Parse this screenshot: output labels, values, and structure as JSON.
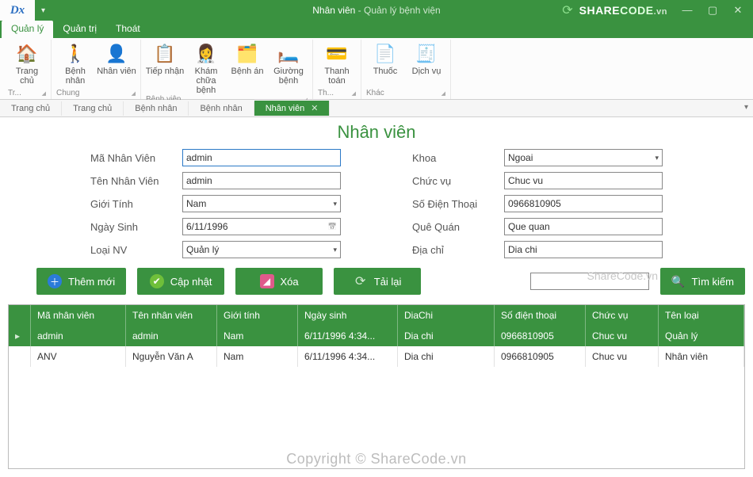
{
  "titlebar": {
    "logo": "Dx",
    "doc": "Nhân viên",
    "app": "Quản lý bệnh viện",
    "brand_share": "SHARE",
    "brand_code": "CODE",
    "brand_vn": ".vn"
  },
  "ribbon": {
    "tabs": [
      "Quản lý",
      "Quản trị",
      "Thoát"
    ],
    "active_tab": 0,
    "groups": [
      {
        "label": "Tr...",
        "items": [
          {
            "label": "Trang\nchủ",
            "icon": "🏠",
            "name": "ribbon-home"
          }
        ]
      },
      {
        "label": "Chung",
        "items": [
          {
            "label": "Bệnh nhân",
            "icon": "🚶",
            "name": "ribbon-patient"
          },
          {
            "label": "Nhân viên",
            "icon": "👤",
            "name": "ribbon-staff"
          }
        ]
      },
      {
        "label": "Bệnh viện",
        "items": [
          {
            "label": "Tiếp nhận",
            "icon": "📋",
            "name": "ribbon-reception"
          },
          {
            "label": "Khám chữa\nbệnh",
            "icon": "👩‍⚕️",
            "name": "ribbon-exam"
          },
          {
            "label": "Bệnh án",
            "icon": "🗂️",
            "name": "ribbon-record"
          },
          {
            "label": "Giường\nbệnh",
            "icon": "🛏️",
            "name": "ribbon-bed"
          }
        ]
      },
      {
        "label": "Th...",
        "items": [
          {
            "label": "Thanh\ntoán",
            "icon": "💳",
            "name": "ribbon-payment"
          }
        ]
      },
      {
        "label": "Khác",
        "items": [
          {
            "label": "Thuốc",
            "icon": "📄",
            "name": "ribbon-medicine"
          },
          {
            "label": "Dịch vụ",
            "icon": "🧾",
            "name": "ribbon-service"
          }
        ]
      }
    ]
  },
  "doctabs": {
    "tabs": [
      "Trang chủ",
      "Trang chủ",
      "Bệnh nhân",
      "Bệnh nhân",
      "Nhân viên"
    ],
    "active": 4
  },
  "page": {
    "title": "Nhân viên",
    "left": [
      {
        "label": "Mã Nhân Viên",
        "value": "admin",
        "type": "text",
        "hi": true,
        "name": "field-staff-id"
      },
      {
        "label": "Tên Nhân Viên",
        "value": "admin",
        "type": "text",
        "name": "field-staff-name"
      },
      {
        "label": "Giới Tính",
        "value": "Nam",
        "type": "select",
        "name": "field-gender"
      },
      {
        "label": "Ngày Sinh",
        "value": "6/11/1996",
        "type": "date",
        "name": "field-birthdate"
      },
      {
        "label": "Loại NV",
        "value": "Quản lý",
        "type": "select",
        "name": "field-staff-type"
      }
    ],
    "right": [
      {
        "label": "Khoa",
        "value": "Ngoai",
        "type": "select",
        "name": "field-department"
      },
      {
        "label": "Chức vụ",
        "value": "Chuc vu",
        "type": "text",
        "name": "field-position"
      },
      {
        "label": "Số Điện Thoại",
        "value": "0966810905",
        "type": "text",
        "name": "field-phone"
      },
      {
        "label": "Quê Quán",
        "value": "Que quan",
        "type": "text",
        "name": "field-hometown"
      },
      {
        "label": "Địa chỉ",
        "value": "Dia chi",
        "type": "text",
        "name": "field-address"
      }
    ]
  },
  "actions": {
    "add": "Thêm mới",
    "update": "Cập nhật",
    "delete": "Xóa",
    "reload": "Tải lại",
    "search": "Tìm kiếm",
    "search_value": ""
  },
  "grid": {
    "columns": [
      "Mã nhân viên",
      "Tên nhân viên",
      "Giới tính",
      "Ngày sinh",
      "DiaChi",
      "Số điện thoại",
      "Chức vụ",
      "Tên loại"
    ],
    "rows": [
      {
        "selected": true,
        "cells": [
          "admin",
          "admin",
          "Nam",
          "6/11/1996 4:34...",
          "Dia chi",
          "0966810905",
          "Chuc vu",
          "Quản lý"
        ]
      },
      {
        "selected": false,
        "cells": [
          "ANV",
          "Nguyễn Văn A",
          "Nam",
          "6/11/1996 4:34...",
          "Dia chi",
          "0966810905",
          "Chuc vu",
          "Nhân viên"
        ]
      }
    ]
  },
  "watermark": "Copyright © ShareCode.vn",
  "watermark2": "ShareCode.vn"
}
